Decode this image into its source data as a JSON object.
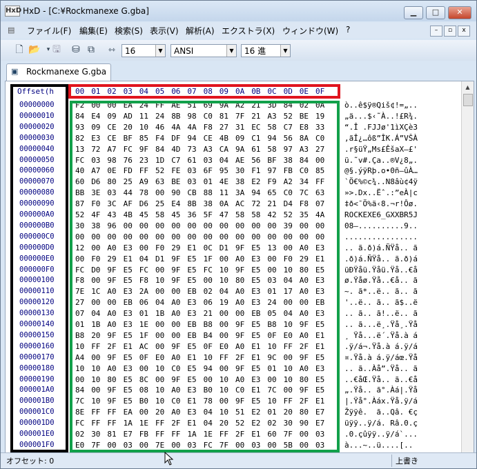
{
  "window": {
    "title": "HxD - [C:¥Rockmanexe G.gba]",
    "app_icon": "HxD"
  },
  "window_controls": {
    "minimize": "▁",
    "maximize": "□",
    "close": "✕"
  },
  "menu": {
    "items": [
      "ファイル(F)",
      "編集(E)",
      "検索(S)",
      "表示(V)",
      "解析(A)",
      "エクストラ(X)",
      "ウィンドウ(W)",
      "?"
    ],
    "mdi_controls": [
      "–",
      "▫",
      "x"
    ]
  },
  "toolbar": {
    "bytes_per_row": "16",
    "charset": "ANSI",
    "offset_base": "16 進"
  },
  "tab": {
    "label": "Rockmanexe G.gba"
  },
  "editor": {
    "offset_header": "Offset(h",
    "columns": [
      "00",
      "01",
      "02",
      "03",
      "04",
      "05",
      "06",
      "07",
      "08",
      "09",
      "0A",
      "0B",
      "0C",
      "0D",
      "0E",
      "0F"
    ],
    "rows": [
      {
        "offset": "00000000",
        "hex": [
          "F2",
          "00",
          "00",
          "EA",
          "24",
          "FF",
          "AE",
          "51",
          "69",
          "9A",
          "A2",
          "21",
          "3D",
          "84",
          "02",
          "0A"
        ],
        "text": "ò..ê$ÿ®Qiš¢!=„.."
      },
      {
        "offset": "00000010",
        "hex": [
          "84",
          "E4",
          "09",
          "AD",
          "11",
          "24",
          "8B",
          "98",
          "C0",
          "81",
          "7F",
          "21",
          "A3",
          "52",
          "BE",
          "19"
        ],
        "text": "„ä..­.$‹˜À..!£R¾."
      },
      {
        "offset": "00000020",
        "hex": [
          "93",
          "09",
          "CE",
          "20",
          "10",
          "46",
          "4A",
          "4A",
          "F8",
          "27",
          "31",
          "EC",
          "58",
          "C7",
          "E8",
          "33"
        ],
        "text": "“.Î .FJJø'1ìXÇè3"
      },
      {
        "offset": "00000030",
        "hex": [
          "82",
          "E3",
          "CE",
          "BF",
          "85",
          "F4",
          "DF",
          "94",
          "CE",
          "4B",
          "09",
          "C1",
          "94",
          "56",
          "8A",
          "C0"
        ],
        "text": "‚ãÎ¿…ôß”ÎK.Á”VŠÀ"
      },
      {
        "offset": "00000040",
        "hex": [
          "13",
          "72",
          "A7",
          "FC",
          "9F",
          "84",
          "4D",
          "73",
          "A3",
          "CA",
          "9A",
          "61",
          "58",
          "97",
          "A3",
          "27"
        ],
        "text": ".r§üŸ„Ms£ÊšaX—£'"
      },
      {
        "offset": "00000050",
        "hex": [
          "FC",
          "03",
          "98",
          "76",
          "23",
          "1D",
          "C7",
          "61",
          "03",
          "04",
          "AE",
          "56",
          "BF",
          "38",
          "84",
          "00"
        ],
        "text": "ü.˜v#.Ça..®V¿8„."
      },
      {
        "offset": "00000060",
        "hex": [
          "40",
          "A7",
          "0E",
          "FD",
          "FF",
          "52",
          "FE",
          "03",
          "6F",
          "95",
          "30",
          "F1",
          "97",
          "FB",
          "C0",
          "85"
        ],
        "text": "@§.ýÿRþ.o•0ñ—ûÀ…"
      },
      {
        "offset": "00000070",
        "hex": [
          "60",
          "D6",
          "80",
          "25",
          "A9",
          "63",
          "BE",
          "03",
          "01",
          "4E",
          "38",
          "E2",
          "F9",
          "A2",
          "34",
          "FF"
        ],
        "text": "`Ö€%©c¾..N8âù¢4ÿ"
      },
      {
        "offset": "00000080",
        "hex": [
          "BB",
          "3E",
          "03",
          "44",
          "78",
          "00",
          "90",
          "CB",
          "88",
          "11",
          "3A",
          "94",
          "65",
          "C0",
          "7C",
          "63"
        ],
        "text": "»>.Dx..Ëˆ.:”eÀ|c"
      },
      {
        "offset": "00000090",
        "hex": [
          "87",
          "F0",
          "3C",
          "AF",
          "D6",
          "25",
          "E4",
          "8B",
          "38",
          "0A",
          "AC",
          "72",
          "21",
          "D4",
          "F8",
          "07"
        ],
        "text": "‡ð<¯Ö%ä‹8.¬r!Ôø."
      },
      {
        "offset": "000000A0",
        "hex": [
          "52",
          "4F",
          "43",
          "4B",
          "45",
          "58",
          "45",
          "36",
          "5F",
          "47",
          "58",
          "58",
          "42",
          "52",
          "35",
          "4A"
        ],
        "text": "ROCKEXE6_GXXBR5J"
      },
      {
        "offset": "000000B0",
        "hex": [
          "30",
          "38",
          "96",
          "00",
          "00",
          "00",
          "00",
          "00",
          "00",
          "00",
          "00",
          "00",
          "00",
          "39",
          "00",
          "00"
        ],
        "text": "08–..........9.."
      },
      {
        "offset": "000000C0",
        "hex": [
          "00",
          "00",
          "00",
          "00",
          "00",
          "00",
          "00",
          "00",
          "00",
          "00",
          "00",
          "00",
          "00",
          "00",
          "00",
          "00"
        ],
        "text": "................"
      },
      {
        "offset": "000000D0",
        "hex": [
          "12",
          "00",
          "A0",
          "E3",
          "00",
          "F0",
          "29",
          "E1",
          "0C",
          "D1",
          "9F",
          "E5",
          "13",
          "00",
          "A0",
          "E3"
        ],
        "text": ".. ã.ð)á.ÑŸå.. ã"
      },
      {
        "offset": "000000E0",
        "hex": [
          "00",
          "F0",
          "29",
          "E1",
          "04",
          "D1",
          "9F",
          "E5",
          "1F",
          "00",
          "A0",
          "E3",
          "00",
          "F0",
          "29",
          "E1"
        ],
        "text": ".ð)á.ÑŸå.. ã.ð)á"
      },
      {
        "offset": "000000F0",
        "hex": [
          "FC",
          "D0",
          "9F",
          "E5",
          "FC",
          "00",
          "9F",
          "E5",
          "FC",
          "10",
          "9F",
          "E5",
          "00",
          "10",
          "80",
          "E5"
        ],
        "text": "üÐŸåü.Ÿåü.Ÿå..€å"
      },
      {
        "offset": "00000100",
        "hex": [
          "F8",
          "00",
          "9F",
          "E5",
          "F8",
          "10",
          "9F",
          "E5",
          "00",
          "10",
          "80",
          "E5",
          "03",
          "04",
          "A0",
          "E3"
        ],
        "text": "ø.Ÿåø.Ÿå..€å.. ã"
      },
      {
        "offset": "00000110",
        "hex": [
          "7E",
          "1C",
          "A0",
          "E3",
          "2A",
          "00",
          "00",
          "EB",
          "02",
          "04",
          "A0",
          "E3",
          "01",
          "17",
          "A0",
          "E3"
        ],
        "text": "~. ã*..ë.. ã.. ã"
      },
      {
        "offset": "00000120",
        "hex": [
          "27",
          "00",
          "00",
          "EB",
          "06",
          "04",
          "A0",
          "E3",
          "06",
          "19",
          "A0",
          "E3",
          "24",
          "00",
          "00",
          "EB"
        ],
        "text": "'..ë.. ã.. ã$..ë"
      },
      {
        "offset": "00000130",
        "hex": [
          "07",
          "04",
          "A0",
          "E3",
          "01",
          "1B",
          "A0",
          "E3",
          "21",
          "00",
          "00",
          "EB",
          "05",
          "04",
          "A0",
          "E3"
        ],
        "text": ".. ã.. ã!..ë.. ã"
      },
      {
        "offset": "00000140",
        "hex": [
          "01",
          "1B",
          "A0",
          "E3",
          "1E",
          "00",
          "00",
          "EB",
          "B8",
          "00",
          "9F",
          "E5",
          "B8",
          "10",
          "9F",
          "E5"
        ],
        "text": ".. ã...ë¸.Ÿå¸.Ÿå"
      },
      {
        "offset": "00000150",
        "hex": [
          "B8",
          "20",
          "9F",
          "E5",
          "1F",
          "00",
          "00",
          "EB",
          "B4",
          "00",
          "9F",
          "E5",
          "0F",
          "E0",
          "A0",
          "E1"
        ],
        "text": "¸ Ÿå...ë´.Ÿå.à á"
      },
      {
        "offset": "00000160",
        "hex": [
          "10",
          "FF",
          "2F",
          "E1",
          "AC",
          "00",
          "9F",
          "E5",
          "0F",
          "E0",
          "A0",
          "E1",
          "10",
          "FF",
          "2F",
          "E1"
        ],
        "text": ".ÿ/á¬.Ÿå.à á.ÿ/á"
      },
      {
        "offset": "00000170",
        "hex": [
          "A4",
          "00",
          "9F",
          "E5",
          "0F",
          "E0",
          "A0",
          "E1",
          "10",
          "FF",
          "2F",
          "E1",
          "9C",
          "00",
          "9F",
          "E5"
        ],
        "text": "¤.Ÿå.à á.ÿ/áœ.Ÿå"
      },
      {
        "offset": "00000180",
        "hex": [
          "10",
          "10",
          "A0",
          "E3",
          "00",
          "10",
          "C0",
          "E5",
          "94",
          "00",
          "9F",
          "E5",
          "01",
          "10",
          "A0",
          "E3"
        ],
        "text": ".. ã..Àå”.Ÿå.. ã"
      },
      {
        "offset": "00000190",
        "hex": [
          "00",
          "10",
          "80",
          "E5",
          "8C",
          "00",
          "9F",
          "E5",
          "00",
          "10",
          "A0",
          "E3",
          "00",
          "10",
          "80",
          "E5"
        ],
        "text": "..€åŒ.Ÿå.. ã..€å"
      },
      {
        "offset": "000001A0",
        "hex": [
          "84",
          "00",
          "9F",
          "E5",
          "08",
          "10",
          "A0",
          "E3",
          "B0",
          "10",
          "C0",
          "E1",
          "7C",
          "00",
          "9F",
          "E5"
        ],
        "text": "„.Ÿå.. ã°.Àá|.Ÿå"
      },
      {
        "offset": "000001B0",
        "hex": [
          "7C",
          "10",
          "9F",
          "E5",
          "B0",
          "10",
          "C0",
          "E1",
          "78",
          "00",
          "9F",
          "E5",
          "10",
          "FF",
          "2F",
          "E1"
        ],
        "text": "|.Ÿå°.Àáx.Ÿå.ÿ/á"
      },
      {
        "offset": "000001C0",
        "hex": [
          "8E",
          "FF",
          "FF",
          "EA",
          "00",
          "20",
          "A0",
          "E3",
          "04",
          "10",
          "51",
          "E2",
          "01",
          "20",
          "80",
          "E7"
        ],
        "text": "Žÿÿê.  ã..Qâ. €ç"
      },
      {
        "offset": "000001D0",
        "hex": [
          "FC",
          "FF",
          "FF",
          "1A",
          "1E",
          "FF",
          "2F",
          "E1",
          "04",
          "20",
          "52",
          "E2",
          "02",
          "30",
          "90",
          "E7"
        ],
        "text": "üÿÿ..ÿ/á. Râ.0.ç"
      },
      {
        "offset": "000001E0",
        "hex": [
          "02",
          "30",
          "81",
          "E7",
          "FB",
          "FF",
          "FF",
          "1A",
          "1E",
          "FF",
          "2F",
          "E1",
          "60",
          "7F",
          "00",
          "03"
        ],
        "text": ".0.çûÿÿ..ÿ/á`..."
      },
      {
        "offset": "000001F0",
        "hex": [
          "E0",
          "7F",
          "00",
          "03",
          "00",
          "7E",
          "00",
          "03",
          "FC",
          "7F",
          "00",
          "03",
          "00",
          "5B",
          "00",
          "03"
        ],
        "text": "à...~..ü....[.."
      }
    ]
  },
  "status": {
    "offset_label": "オフセット: 0",
    "mode": "上書き"
  },
  "colors": {
    "offset_box": "#000000",
    "header_box": "#e0141e",
    "data_box": "#12a04a",
    "offset_text": "#000080"
  }
}
